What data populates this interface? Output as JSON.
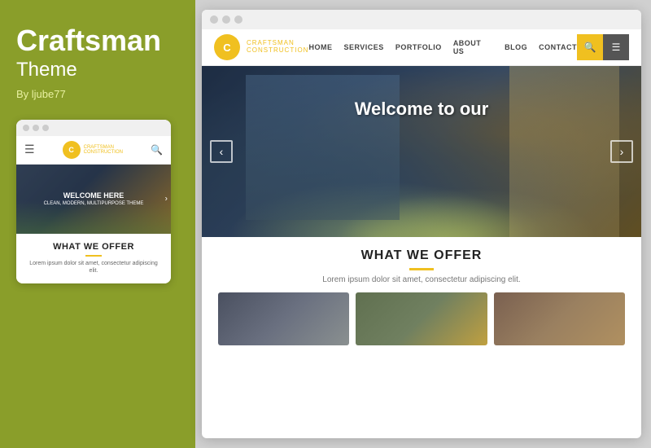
{
  "left": {
    "title": "Craftsman",
    "subtitle": "Theme",
    "author": "By ljube77"
  },
  "mobile": {
    "logo_letter": "C",
    "logo_name": "CRAFTSMAN",
    "logo_sub": "CONSTRUCTION",
    "hero_title": "WELCOME HERE",
    "hero_subtext": "CLEAN, MODERN, MULTIPURPOSE THEME",
    "offer_title": "WHAT WE OFFER",
    "offer_text": "Lorem ipsum dolor sit amet, consectetur adipiscing elit."
  },
  "desktop": {
    "window_dots": [
      "dot1",
      "dot2",
      "dot3"
    ],
    "nav": {
      "logo_letter": "C",
      "logo_name": "CRAFTSMAN",
      "logo_sub": "CONSTRUCTION",
      "links": [
        "HOME",
        "SERVICES",
        "PORTFOLIO",
        "ABOUT US",
        "BLOG",
        "CONTACT"
      ],
      "search_icon": "🔍",
      "menu_icon": "☰"
    },
    "hero": {
      "text": "Welcome to our",
      "arrow_left": "‹",
      "arrow_right": "›"
    },
    "offer": {
      "title": "WHAT WE OFFER",
      "text": "Lorem ipsum dolor sit amet, consectetur adipiscing elit.",
      "images": [
        "construction-team-image",
        "workers-meeting-image",
        "interior-worker-image"
      ]
    }
  }
}
